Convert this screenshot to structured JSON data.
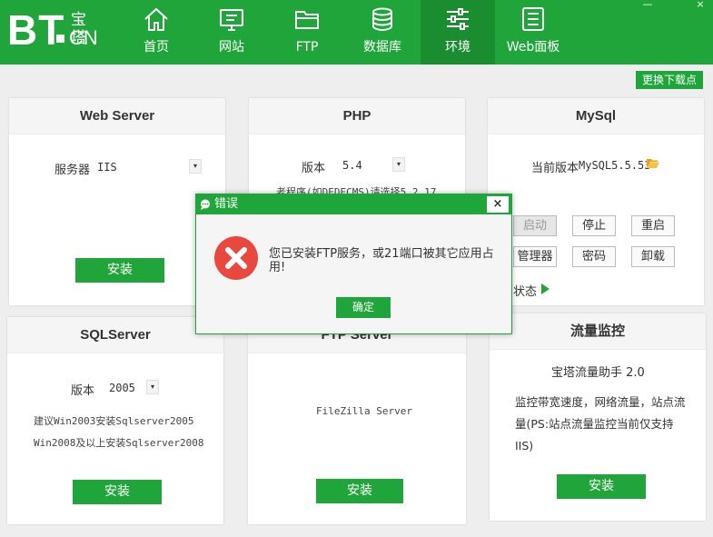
{
  "header": {
    "logo_bt": "BT",
    "logo_cn_top": "宝塔",
    "logo_cn_bottom": "CN",
    "nav": [
      {
        "label": "首页",
        "icon": "home-icon"
      },
      {
        "label": "网站",
        "icon": "monitor-icon"
      },
      {
        "label": "FTP",
        "icon": "folder-icon"
      },
      {
        "label": "数据库",
        "icon": "database-icon"
      },
      {
        "label": "环境",
        "icon": "sliders-icon"
      },
      {
        "label": "Web面板",
        "icon": "list-icon"
      }
    ],
    "active_nav": "环境",
    "window_minimize": "—",
    "window_close": "×"
  },
  "mirror_button": "更换下载点",
  "web_server": {
    "title": "Web Server",
    "server_label": "服务器",
    "server_value": "IIS",
    "install": "安装"
  },
  "php": {
    "title": "PHP",
    "version_label": "版本",
    "version_value": "5.4",
    "hint": "老程序(如DEDECMS)请选择5.2.17"
  },
  "mysql": {
    "title": "MySql",
    "current_label": "当前版本",
    "current_value": "MySQL5.5.53",
    "start": "启动",
    "stop": "停止",
    "restart": "重启",
    "manager": "管理器",
    "password": "密码",
    "uninstall": "卸载",
    "status": "状态"
  },
  "sqlserver": {
    "title": "SQLServer",
    "version_label": "版本",
    "version_value": "2005",
    "hint1": "建议Win2003安装Sqlserver2005",
    "hint2": "Win2008及以上安装Sqlserver2008",
    "install": "安装"
  },
  "ftp": {
    "title": "FTP Server",
    "name": "FileZilla Server",
    "install": "安装"
  },
  "traffic": {
    "title": "流量监控",
    "name": "宝塔流量助手 2.0",
    "desc": "监控带宽速度，网络流量，站点流量(PS:站点流量监控当前仅支持IIS)",
    "install": "安装"
  },
  "dialog": {
    "title": "错误",
    "close": "×",
    "message": "您已安装FTP服务，或21端口被其它应用占用!",
    "ok": "确定"
  },
  "colors": {
    "brand_green": "#20a53a",
    "active_nav": "#1b8d31",
    "error_red": "#e9483e"
  }
}
